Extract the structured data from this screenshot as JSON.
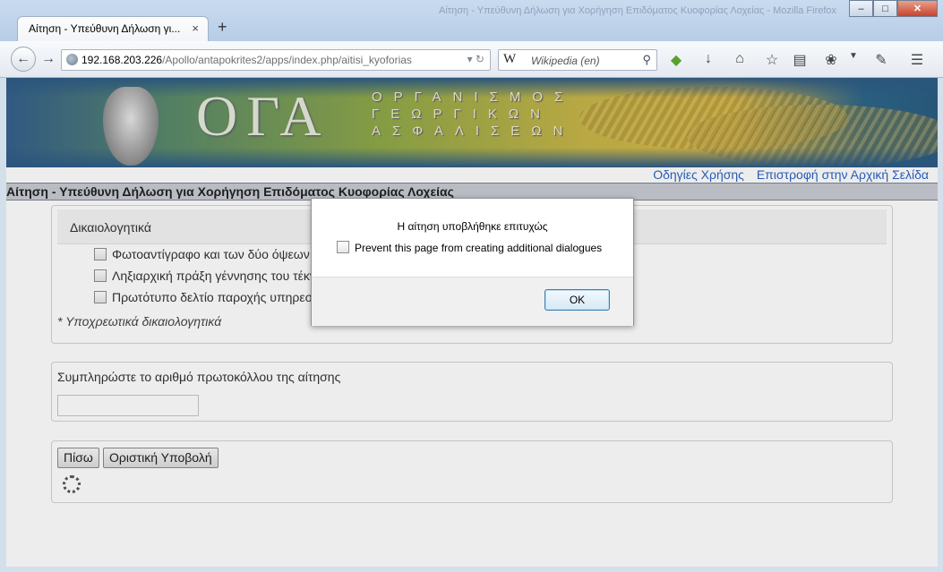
{
  "browser": {
    "tab_title": "Αίτηση - Υπεύθυνη Δήλωση γι...",
    "tab_close": "×",
    "new_tab": "+",
    "url_host": "192.168.203.226",
    "url_path": "/Apollo/antapokrites2/apps/index.php/aitisi_kyoforias",
    "search_engine_glyph": "W",
    "search_placeholder": "Wikipedia (en)",
    "window_controls": {
      "minimize": "–",
      "maximize": "□",
      "close": "✕"
    }
  },
  "banner": {
    "logo_text": "ΟΓΑ",
    "org_name_line1": "ΟΡΓΑΝΙΣΜΟΣ",
    "org_name_line2": "ΓΕΩΡΓΙΚΩΝ",
    "org_name_line3": "ΑΣΦΑΛΙΣΕΩΝ"
  },
  "top_links": {
    "help": "Οδηγίες Χρήσης",
    "home": "Επιστροφή στην Αρχική Σελίδα"
  },
  "page_title": "Αίτηση - Υπεύθυνη Δήλωση για Χορήγηση Επιδόματος Κυοφορίας Λοχείας",
  "documents": {
    "heading": "Δικαιολογητικά",
    "items": [
      "Φωτοαντίγραφο και των δύο όψεων τ",
      "Ληξιαρχική πράξη γέννησης του τέκν",
      "Πρωτότυπο δελτίο παροχής υπηρεσ"
    ],
    "note": "* Υποχρεωτικά δικαιολογητικά"
  },
  "protocol": {
    "label": "Συμπληρώστε το αριθμό πρωτοκόλλου της αίτησης",
    "value": ""
  },
  "actions": {
    "back": "Πίσω",
    "submit": "Οριστική Υποβολή"
  },
  "dialog": {
    "message": "Η αίτηση υποβλήθηκε επιτυχώς",
    "prevent_label": "Prevent this page from creating additional dialogues",
    "ok": "OK"
  }
}
